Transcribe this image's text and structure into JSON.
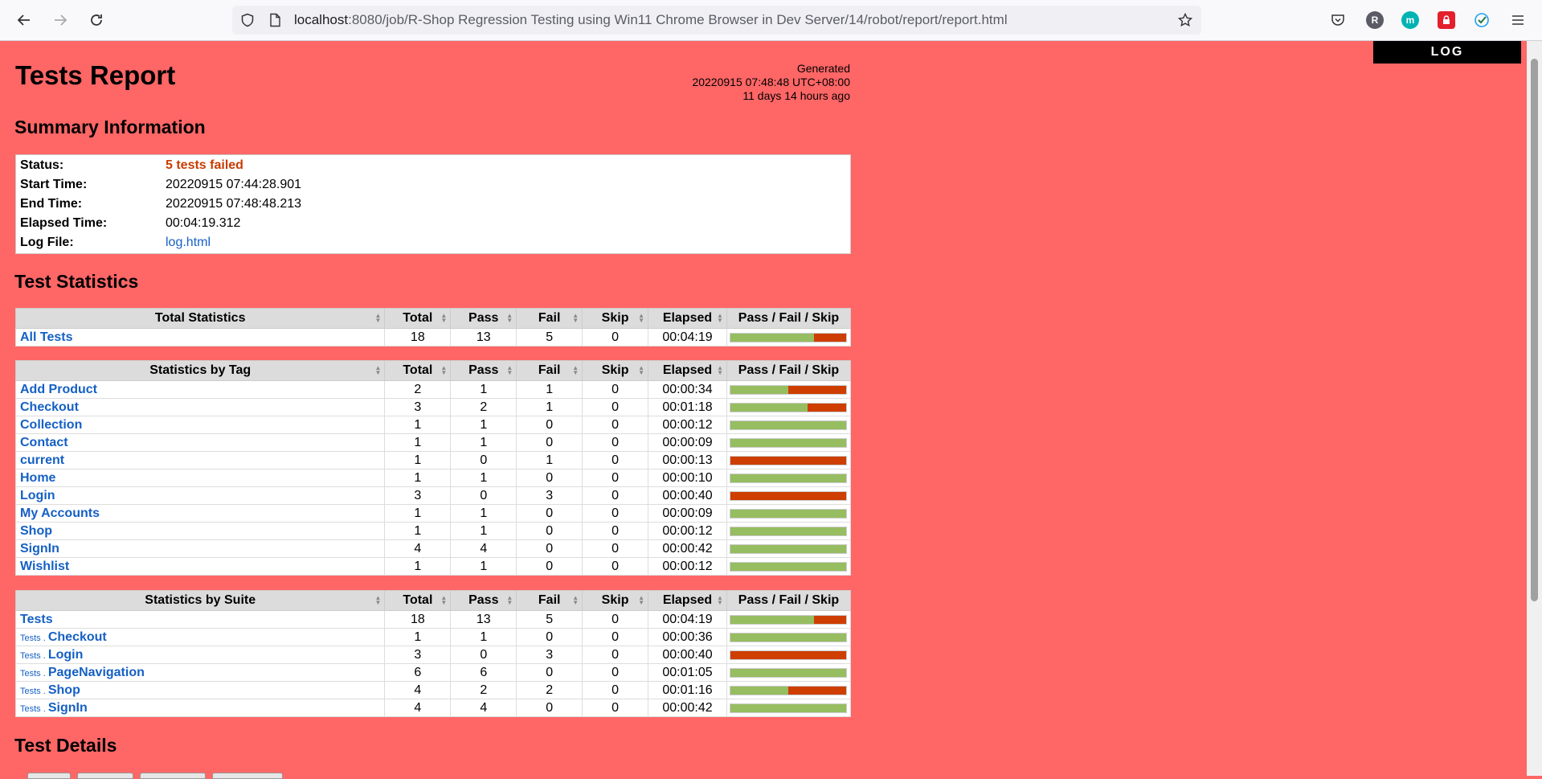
{
  "browser": {
    "url_host": "localhost",
    "url_rest": ":8080/job/R-Shop Regression Testing using Win11 Chrome Browser in Dev Server/14/robot/report/report.html",
    "ext_r": "R",
    "ext_m": "m"
  },
  "page": {
    "log_button": "LOG",
    "title": "Tests Report",
    "generated": {
      "label": "Generated",
      "datetime": "20220915 07:48:48 UTC+08:00",
      "relative": "11 days 14 hours ago"
    },
    "summary_heading": "Summary Information",
    "summary": {
      "status_label": "Status:",
      "status_value": "5 tests failed",
      "start_label": "Start Time:",
      "start_value": "20220915 07:44:28.901",
      "end_label": "End Time:",
      "end_value": "20220915 07:48:48.213",
      "elapsed_label": "Elapsed Time:",
      "elapsed_value": "00:04:19.312",
      "logfile_label": "Log File:",
      "logfile_value": "log.html"
    },
    "stats_heading": "Test Statistics",
    "details_heading": "Test Details",
    "columns": [
      "Total",
      "Pass",
      "Fail",
      "Skip",
      "Elapsed",
      "Pass / Fail / Skip"
    ],
    "total_stats": {
      "header": "Total Statistics",
      "rows": [
        {
          "name": "All Tests",
          "total": "18",
          "pass": "13",
          "fail": "5",
          "skip": "0",
          "elapsed": "00:04:19"
        }
      ]
    },
    "tag_stats": {
      "header": "Statistics by Tag",
      "rows": [
        {
          "name": "Add Product",
          "total": "2",
          "pass": "1",
          "fail": "1",
          "skip": "0",
          "elapsed": "00:00:34"
        },
        {
          "name": "Checkout",
          "total": "3",
          "pass": "2",
          "fail": "1",
          "skip": "0",
          "elapsed": "00:01:18"
        },
        {
          "name": "Collection",
          "total": "1",
          "pass": "1",
          "fail": "0",
          "skip": "0",
          "elapsed": "00:00:12"
        },
        {
          "name": "Contact",
          "total": "1",
          "pass": "1",
          "fail": "0",
          "skip": "0",
          "elapsed": "00:00:09"
        },
        {
          "name": "current",
          "total": "1",
          "pass": "0",
          "fail": "1",
          "skip": "0",
          "elapsed": "00:00:13"
        },
        {
          "name": "Home",
          "total": "1",
          "pass": "1",
          "fail": "0",
          "skip": "0",
          "elapsed": "00:00:10"
        },
        {
          "name": "Login",
          "total": "3",
          "pass": "0",
          "fail": "3",
          "skip": "0",
          "elapsed": "00:00:40"
        },
        {
          "name": "My Accounts",
          "total": "1",
          "pass": "1",
          "fail": "0",
          "skip": "0",
          "elapsed": "00:00:09"
        },
        {
          "name": "Shop",
          "total": "1",
          "pass": "1",
          "fail": "0",
          "skip": "0",
          "elapsed": "00:00:12"
        },
        {
          "name": "SignIn",
          "total": "4",
          "pass": "4",
          "fail": "0",
          "skip": "0",
          "elapsed": "00:00:42"
        },
        {
          "name": "Wishlist",
          "total": "1",
          "pass": "1",
          "fail": "0",
          "skip": "0",
          "elapsed": "00:00:12"
        }
      ]
    },
    "suite_stats": {
      "header": "Statistics by Suite",
      "rows": [
        {
          "prefix": "",
          "name": "Tests",
          "total": "18",
          "pass": "13",
          "fail": "5",
          "skip": "0",
          "elapsed": "00:04:19"
        },
        {
          "prefix": "Tests . ",
          "name": "Checkout",
          "total": "1",
          "pass": "1",
          "fail": "0",
          "skip": "0",
          "elapsed": "00:00:36"
        },
        {
          "prefix": "Tests . ",
          "name": "Login",
          "total": "3",
          "pass": "0",
          "fail": "3",
          "skip": "0",
          "elapsed": "00:00:40"
        },
        {
          "prefix": "Tests . ",
          "name": "PageNavigation",
          "total": "6",
          "pass": "6",
          "fail": "0",
          "skip": "0",
          "elapsed": "00:01:05"
        },
        {
          "prefix": "Tests . ",
          "name": "Shop",
          "total": "4",
          "pass": "2",
          "fail": "2",
          "skip": "0",
          "elapsed": "00:01:16"
        },
        {
          "prefix": "Tests . ",
          "name": "SignIn",
          "total": "4",
          "pass": "4",
          "fail": "0",
          "skip": "0",
          "elapsed": "00:00:42"
        }
      ]
    }
  },
  "colors": {
    "background": "#ff6666",
    "pass": "#97bd61",
    "fail": "#ce3e01",
    "skip": "#fed84f",
    "link": "#1560c4"
  }
}
